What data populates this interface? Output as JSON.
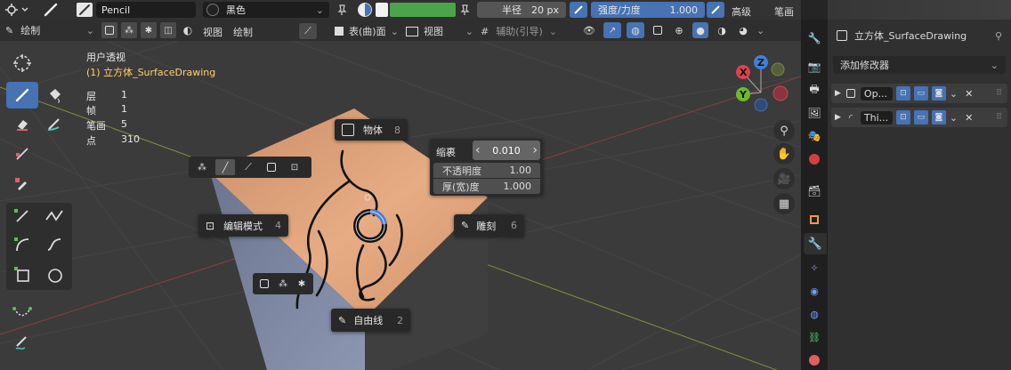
{
  "header": {
    "brush_name": "Pencil",
    "color_name": "黑色",
    "radius_label": "半径",
    "radius_value": "20 px",
    "strength_label": "强度/力度",
    "strength_value": "1.000",
    "right_cut_1": "高级",
    "right_cut_2": "笔画"
  },
  "toolbar2": {
    "mode": "绘制",
    "view": "视图",
    "draw": "绘制",
    "surface": "表(曲)面",
    "view2": "视图",
    "guides": "辅助(引导)"
  },
  "viewport_info": {
    "perspective": "用户透视",
    "object": "(1) 立方体_SurfaceDrawing",
    "stats": [
      {
        "label": "层",
        "value": "1"
      },
      {
        "label": "帧",
        "value": "1"
      },
      {
        "label": "笔画",
        "value": "5"
      },
      {
        "label": "点",
        "value": "310"
      }
    ]
  },
  "pie_menu": {
    "object": {
      "label": "物体",
      "key": "8"
    },
    "edit": {
      "label": "编辑模式",
      "key": "4"
    },
    "sculpt": {
      "label": "雕刻",
      "key": "6"
    },
    "freehand": {
      "label": "自由线",
      "key": "2"
    }
  },
  "popover": {
    "scale_label": "缩裹",
    "scale_value": "0.010",
    "opacity_label": "不透明度",
    "opacity_value": "1.00",
    "thickness_label": "厚(宽)度",
    "thickness_value": "1.000"
  },
  "gizmo": {
    "z": "Z",
    "x": "X",
    "y": "Y"
  },
  "properties": {
    "object_name": "立方体_SurfaceDrawing",
    "add_modifier": "添加修改器",
    "modifiers": [
      {
        "name": "Op..."
      },
      {
        "name": "Thi..."
      }
    ]
  },
  "colors": {
    "active_blue": "#4772b3",
    "green_swatch": "#4aa54a",
    "face_orange": "#e0a57e"
  }
}
